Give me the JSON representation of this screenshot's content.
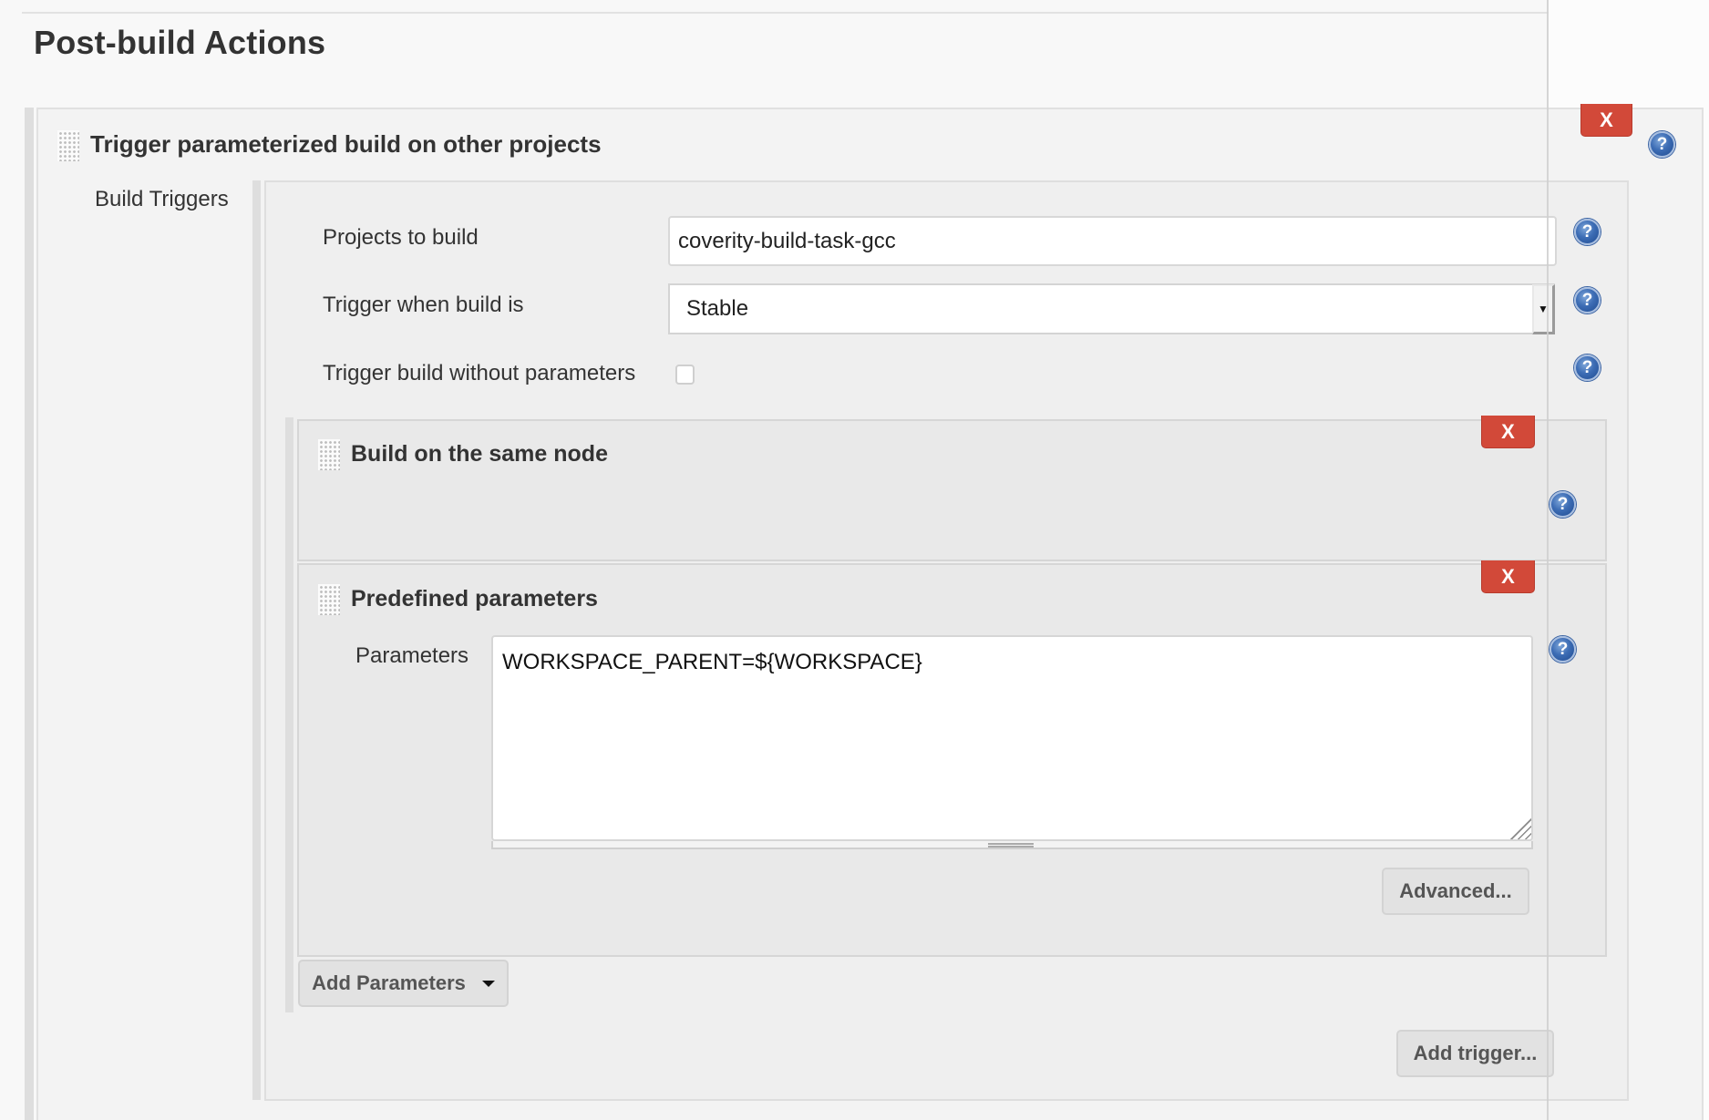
{
  "section": {
    "title": "Post-build Actions"
  },
  "trigger_block": {
    "title": "Trigger parameterized build on other projects",
    "delete_label": "X",
    "help_label": "?",
    "group_label": "Build Triggers",
    "fields": {
      "projects_label": "Projects to build",
      "projects_value": "coverity-build-task-gcc",
      "trigger_when_label": "Trigger when build is",
      "trigger_when_value": "Stable",
      "without_params_label": "Trigger build without parameters",
      "without_params_checked": false
    },
    "sub_blocks": [
      {
        "title": "Build on the same node",
        "delete_label": "X",
        "help_label": "?"
      },
      {
        "title": "Predefined parameters",
        "delete_label": "X",
        "help_label": "?",
        "parameters_label": "Parameters",
        "parameters_value": "WORKSPACE_PARENT=${WORKSPACE}",
        "advanced_label": "Advanced..."
      }
    ],
    "add_parameters_label": "Add Parameters",
    "add_trigger_label": "Add trigger..."
  },
  "colors": {
    "delete_button": "#d24939",
    "help_icon": "#3d6db5",
    "panel_bg": "#f3f3f3"
  }
}
